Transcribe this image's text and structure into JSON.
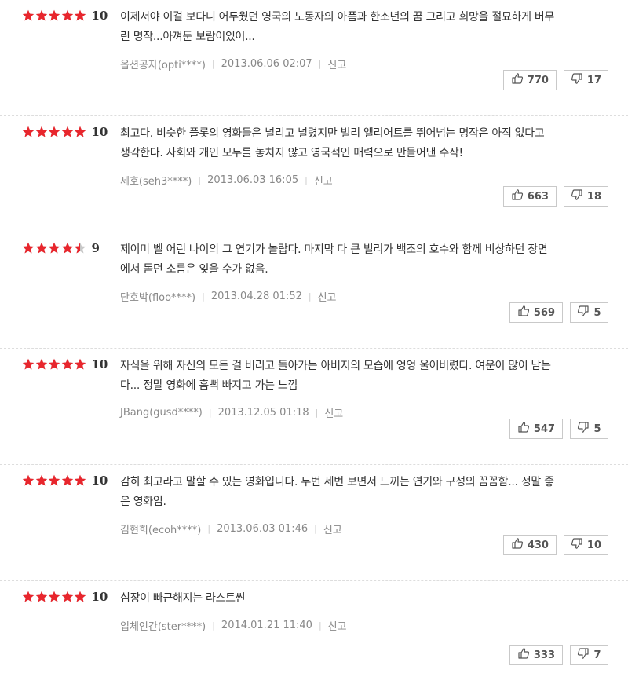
{
  "colors": {
    "star": "#e8262d",
    "star_empty": "#c8c8c8"
  },
  "reviews": [
    {
      "stars": 5,
      "score": "10",
      "lines": [
        "이제서야 이걸 보다니 어두웠던 영국의 노동자의 아픔과 한소년의 꿈 그리고 희망을 절묘하게 버무",
        "린 명작...아껴둔 보람이있어..."
      ],
      "author": "옵션공자(opti****)",
      "date": "2013.06.06 02:07",
      "report": "신고",
      "likes": "770",
      "dislikes": "17"
    },
    {
      "stars": 5,
      "score": "10",
      "lines": [
        "최고다. 비슷한 플롯의 영화들은 널리고 널렸지만 빌리 엘리어트를 뛰어넘는 명작은 아직 없다고",
        "생각한다. 사회와 개인 모두를 놓치지 않고 영국적인 매력으로 만들어낸 수작!"
      ],
      "author": "세호(seh3****)",
      "date": "2013.06.03 16:05",
      "report": "신고",
      "likes": "663",
      "dislikes": "18"
    },
    {
      "stars": 4.5,
      "score": "9",
      "lines": [
        "제이미 벨 어린 나이의 그 연기가 놀랍다. 마지막 다 큰 빌리가 백조의 호수와 함께 비상하던 장면",
        "에서 돋던 소름은 잊을 수가 없음."
      ],
      "author": "단호박(floo****)",
      "date": "2013.04.28 01:52",
      "report": "신고",
      "likes": "569",
      "dislikes": "5"
    },
    {
      "stars": 5,
      "score": "10",
      "lines": [
        "자식을 위해 자신의 모든 걸 버리고 돌아가는 아버지의 모습에 엉엉 울어버렸다. 여운이 많이 남는",
        "다... 정말 영화에 흠뻑 빠지고 가는 느낌"
      ],
      "author": "JBang(gusd****)",
      "date": "2013.12.05 01:18",
      "report": "신고",
      "likes": "547",
      "dislikes": "5"
    },
    {
      "stars": 5,
      "score": "10",
      "lines": [
        "감히 최고라고 말할 수 있는 영화입니다. 두번 세번 보면서 느끼는 연기와 구성의 꼼꼼함... 정말 좋",
        "은 영화임."
      ],
      "author": "김현희(ecoh****)",
      "date": "2013.06.03 01:46",
      "report": "신고",
      "likes": "430",
      "dislikes": "10"
    },
    {
      "stars": 5,
      "score": "10",
      "lines": [
        "심장이 빠근해지는 라스트씬"
      ],
      "author": "입체인간(ster****)",
      "date": "2014.01.21 11:40",
      "report": "신고",
      "likes": "333",
      "dislikes": "7"
    }
  ]
}
